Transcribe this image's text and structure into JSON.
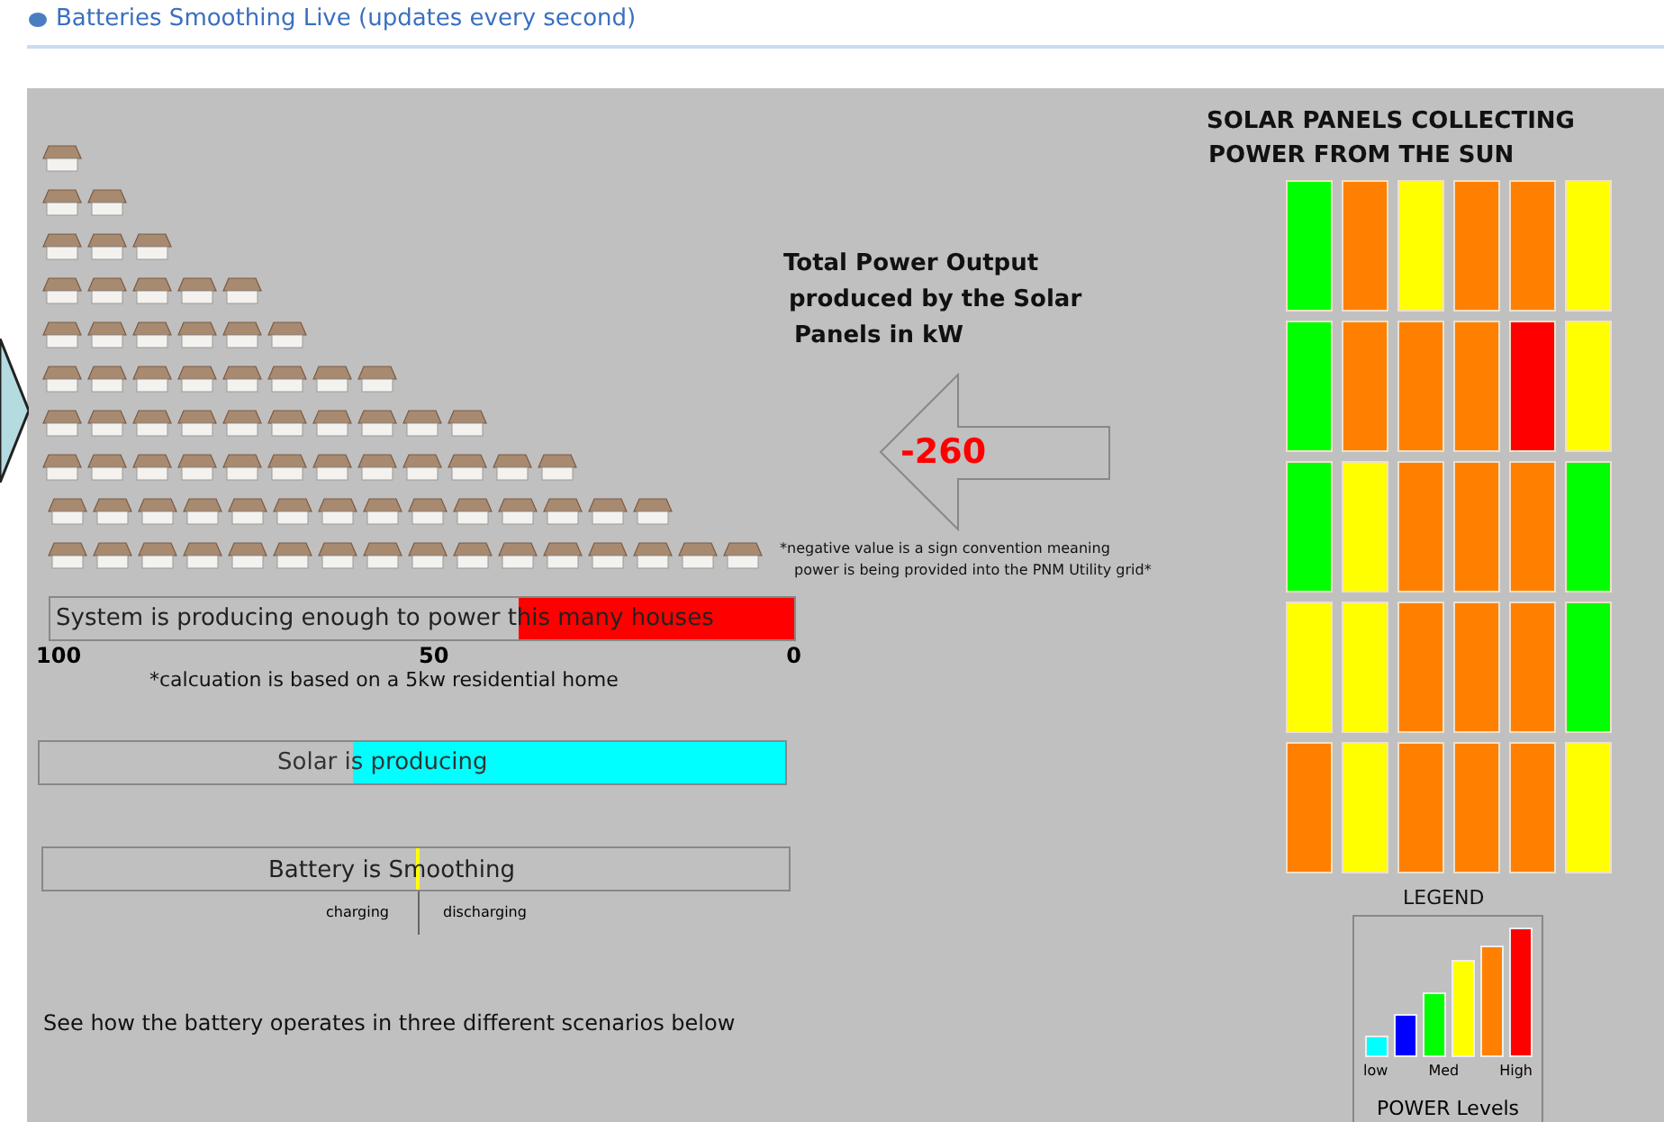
{
  "header": {
    "title": "Batteries Smoothing Live (updates every second)"
  },
  "houses_meter": {
    "label": "System is producing enough to power this many houses",
    "level": 0.37,
    "scale": [
      "100",
      "50",
      "0"
    ],
    "note": "*calcuation is based on a 5kw residential home"
  },
  "solar_meter": {
    "label": "Solar is producing",
    "level": 0.58
  },
  "battery_meter": {
    "label": "Battery is Smoothing",
    "level": 0.5,
    "left_label": "charging",
    "right_label": "discharging"
  },
  "scenarios_text": "See how the battery operates in three different scenarios below",
  "power_output": {
    "title_lines": [
      "Total Power Output",
      "produced by the Solar",
      "Panels in kW"
    ],
    "value": "-260",
    "note_lines": [
      "*negative value is a sign convention meaning",
      "power is being provided into the PNM Utility grid*"
    ]
  },
  "solar_panels": {
    "title_lines": [
      "SOLAR PANELS COLLECTING",
      "POWER FROM THE SUN"
    ],
    "rows": [
      [
        {
          "color": "#00ff00"
        },
        {
          "color": "#ff8000"
        },
        {
          "color": "#ffff00"
        },
        {
          "color": "#ff8000"
        },
        {
          "color": "#ff8000"
        },
        {
          "color": "#ffff00"
        }
      ],
      [
        {
          "color": "#00ff00"
        },
        {
          "color": "#ff8000"
        },
        {
          "color": "#ff8000"
        },
        {
          "color": "#ff8000"
        },
        {
          "color": "#ff0000"
        },
        {
          "color": "#ffff00"
        }
      ],
      [
        {
          "color": "#00ff00"
        },
        {
          "color": "#ffff00"
        },
        {
          "color": "#ff8000"
        },
        {
          "color": "#ff8000"
        },
        {
          "color": "#ff8000"
        },
        {
          "color": "#00ff00"
        }
      ],
      [
        {
          "color": "#ffff00"
        },
        {
          "color": "#ffff00"
        },
        {
          "color": "#ff8000"
        },
        {
          "color": "#ff8000"
        },
        {
          "color": "#ff8000"
        },
        {
          "color": "#00ff00"
        }
      ],
      [
        {
          "color": "#ff8000"
        },
        {
          "color": "#ffff00"
        },
        {
          "color": "#ff8000"
        },
        {
          "color": "#ff8000"
        },
        {
          "color": "#ff8000"
        },
        {
          "color": "#ffff00"
        }
      ]
    ]
  },
  "legend": {
    "title": "LEGEND",
    "bars": [
      {
        "color": "#00ffff"
      },
      {
        "color": "#0000ff"
      },
      {
        "color": "#00ff00"
      },
      {
        "color": "#ffff00"
      },
      {
        "color": "#ff8000"
      },
      {
        "color": "#ff0000"
      }
    ],
    "labels": [
      "low",
      "Med",
      "High"
    ],
    "caption": "POWER Levels"
  }
}
